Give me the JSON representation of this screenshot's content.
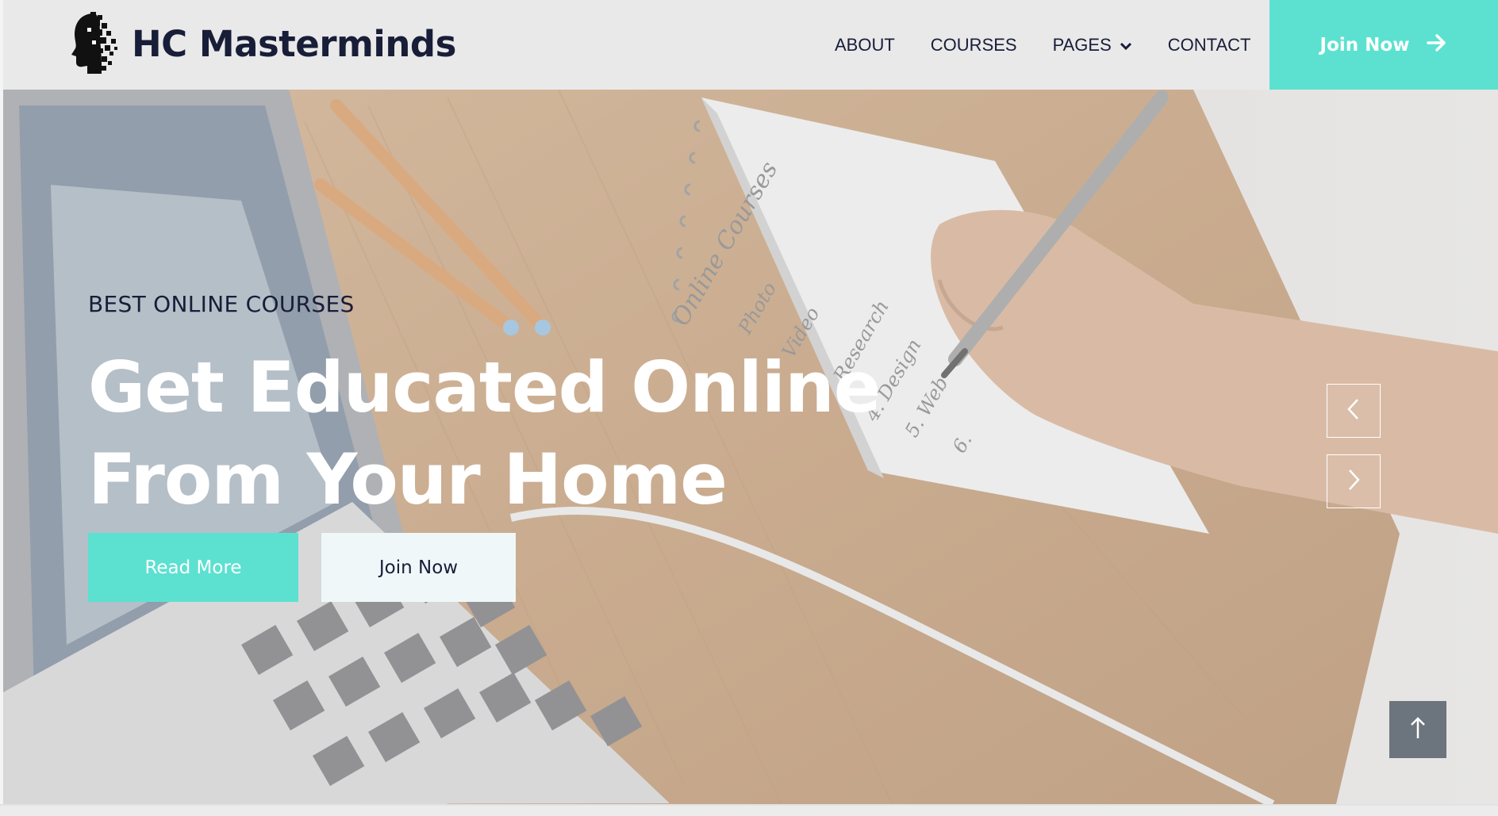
{
  "brand": {
    "name": "HC Masterminds",
    "logo_icon": "pixel-head-icon"
  },
  "nav": {
    "items": [
      {
        "label": "ABOUT"
      },
      {
        "label": "COURSES"
      },
      {
        "label": "PAGES",
        "has_dropdown": true
      },
      {
        "label": "CONTACT"
      }
    ],
    "join_label": "Join Now",
    "join_icon": "arrow-right-icon"
  },
  "hero": {
    "eyebrow": "BEST ONLINE COURSES",
    "headline_line1": "Get Educated Online",
    "headline_line2": "From Your Home",
    "read_more_label": "Read More",
    "join_now_label": "Join Now",
    "prev_icon": "chevron-left-icon",
    "next_icon": "chevron-right-icon",
    "notebook_text": [
      "Online Courses",
      "Photo",
      "Video",
      "Research",
      "4. Design",
      "5. Web",
      "6."
    ]
  },
  "back_to_top_icon": "arrow-up-icon",
  "colors": {
    "accent": "#5ce1d0",
    "dark": "#181d38",
    "light_button": "#f0f7f9",
    "back_to_top": "#6c757d",
    "navbar": "#e9e9e9"
  }
}
